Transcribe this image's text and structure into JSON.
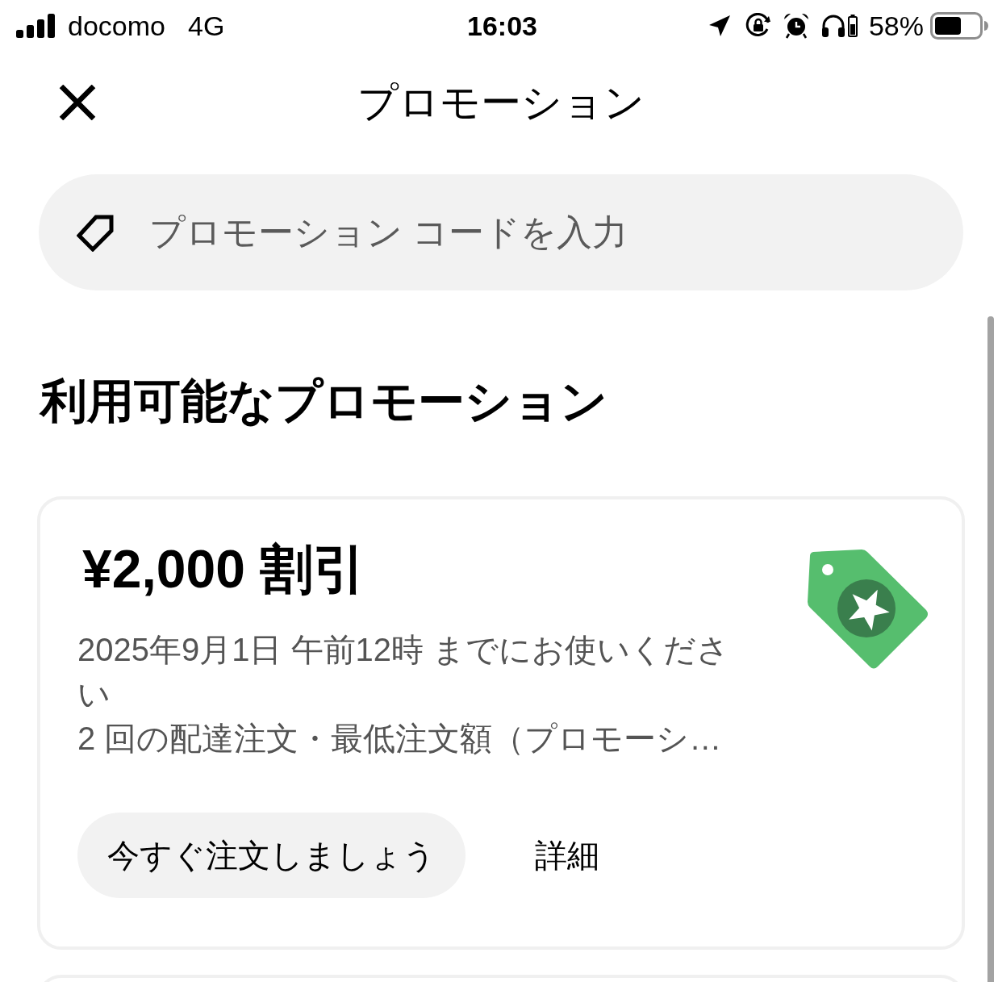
{
  "status_bar": {
    "carrier": "docomo",
    "network": "4G",
    "time": "16:03",
    "battery_percent": "58%"
  },
  "header": {
    "title": "プロモーション"
  },
  "promo_code_field": {
    "placeholder": "プロモーション コードを入力"
  },
  "section": {
    "title": "利用可能なプロモーション"
  },
  "promotions": [
    {
      "title": "¥2,000 割引",
      "details": [
        "2025年9月1日 午前12時 までにお使いください",
        "2 回の配達注文・最低注文額（プロモーシ…"
      ],
      "buttons": [
        {
          "label": "今すぐ注文しましょう",
          "kind": "primary"
        },
        {
          "label": "詳細",
          "kind": "text"
        }
      ]
    }
  ]
}
